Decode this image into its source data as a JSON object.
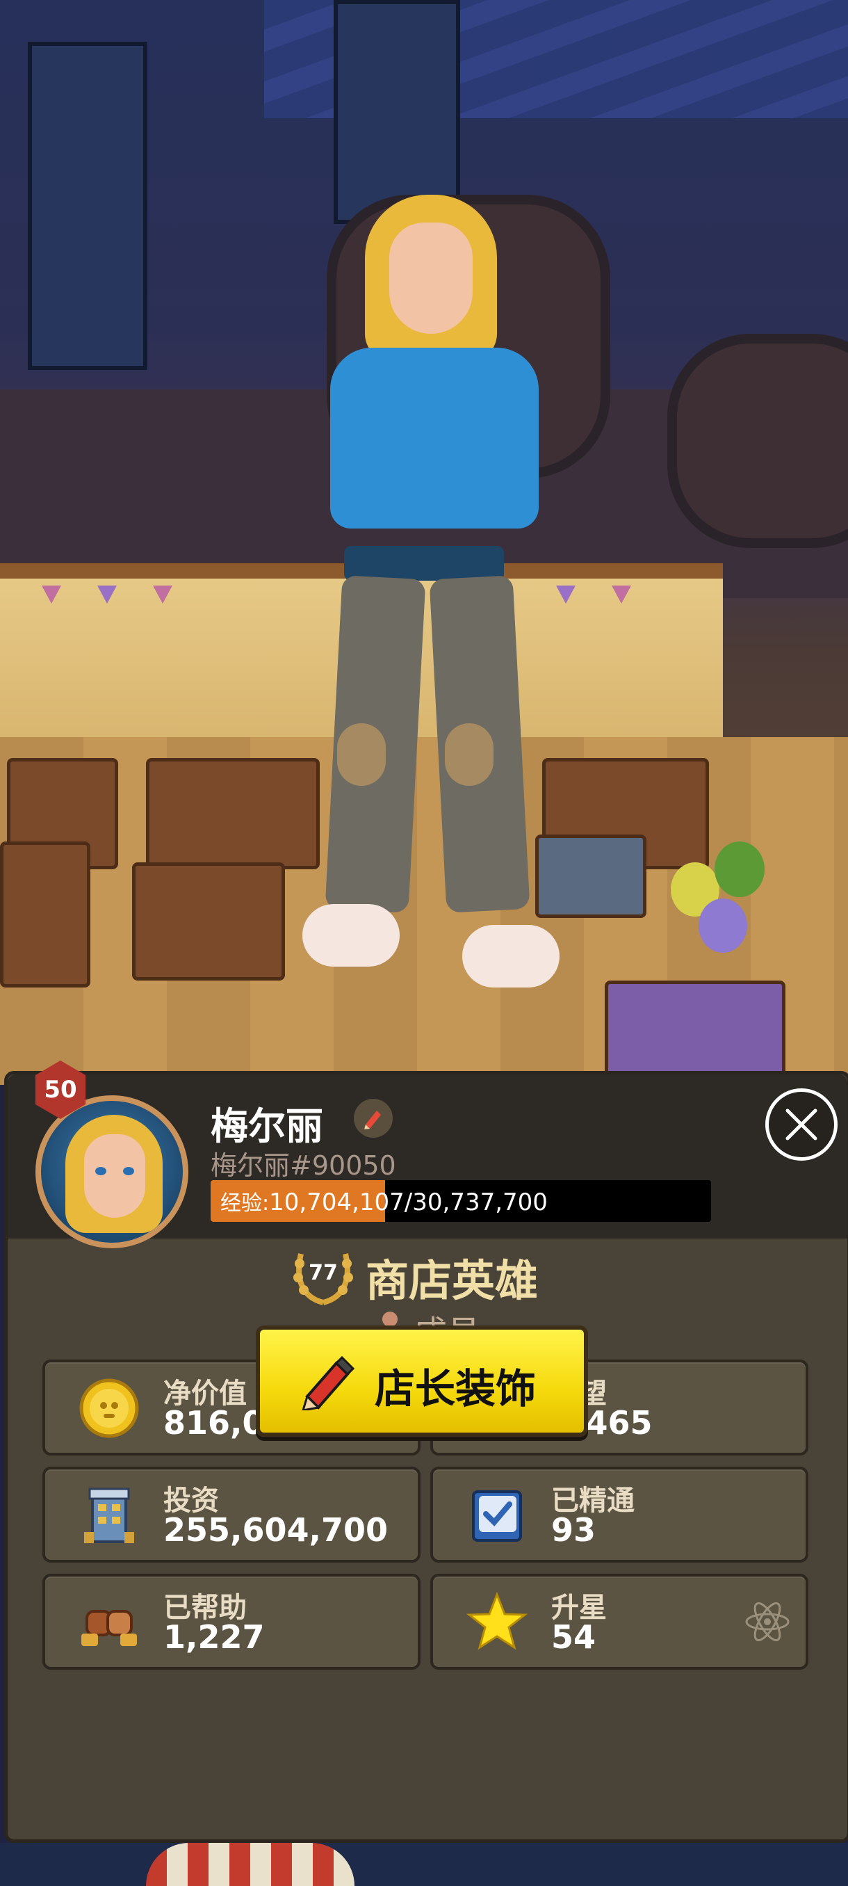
{
  "player": {
    "level": "50",
    "name": "梅尔丽",
    "id": "梅尔丽#90050",
    "xp_label": "经验:",
    "xp_value": "10,704,107/30,737,700",
    "xp_progress": 0.348
  },
  "rank": {
    "number": "77",
    "title": "商店英雄",
    "role": "成员"
  },
  "stats": [
    {
      "label": "净价值",
      "value": "816,025,050",
      "icon": "gold-coin-icon"
    },
    {
      "label": "声望",
      "value": "6,465",
      "icon": "trophy-icon"
    },
    {
      "label": "投资",
      "value": "255,604,700",
      "icon": "building-icon"
    },
    {
      "label": "已精通",
      "value": "93",
      "icon": "mastery-book-icon"
    },
    {
      "label": "已帮助",
      "value": "1,227",
      "icon": "fist-bump-icon"
    },
    {
      "label": "升星",
      "value": "54",
      "icon": "star-icon"
    }
  ],
  "decorate_button": {
    "label": "店长装饰",
    "icon": "pencil-icon"
  },
  "colors": {
    "panel": "#4a4337",
    "xp_fill": "#e07823",
    "button_yellow": "#f5d90c",
    "rank_gold": "#f1dfa8",
    "level_badge": "#b3362d"
  }
}
